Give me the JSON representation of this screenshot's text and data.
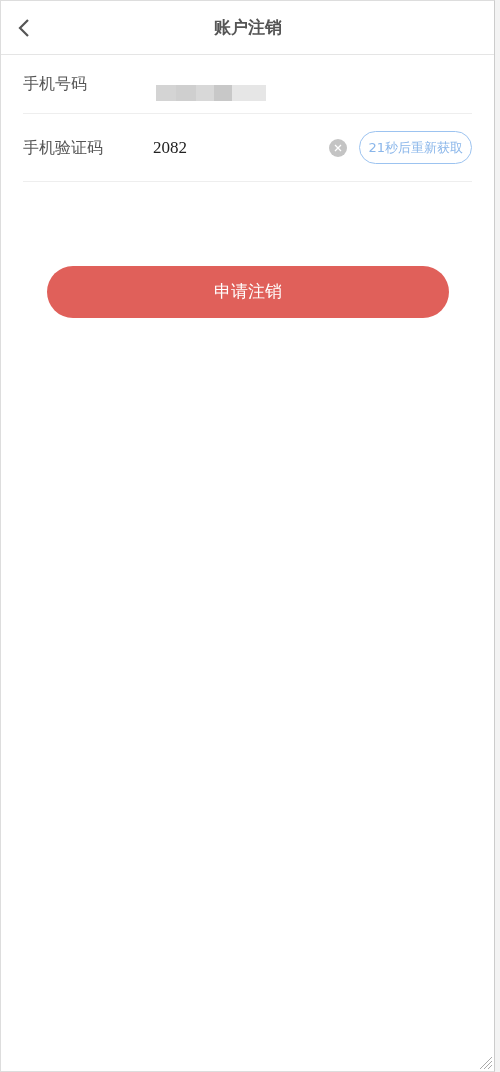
{
  "header": {
    "title": "账户注销"
  },
  "fields": [
    {
      "kind": "redacted",
      "label": "手机号码"
    },
    {
      "kind": "code",
      "label": "手机验证码",
      "value": "2082",
      "resend": "21秒后重新获取"
    }
  ],
  "submit": {
    "label": "申请注销"
  }
}
